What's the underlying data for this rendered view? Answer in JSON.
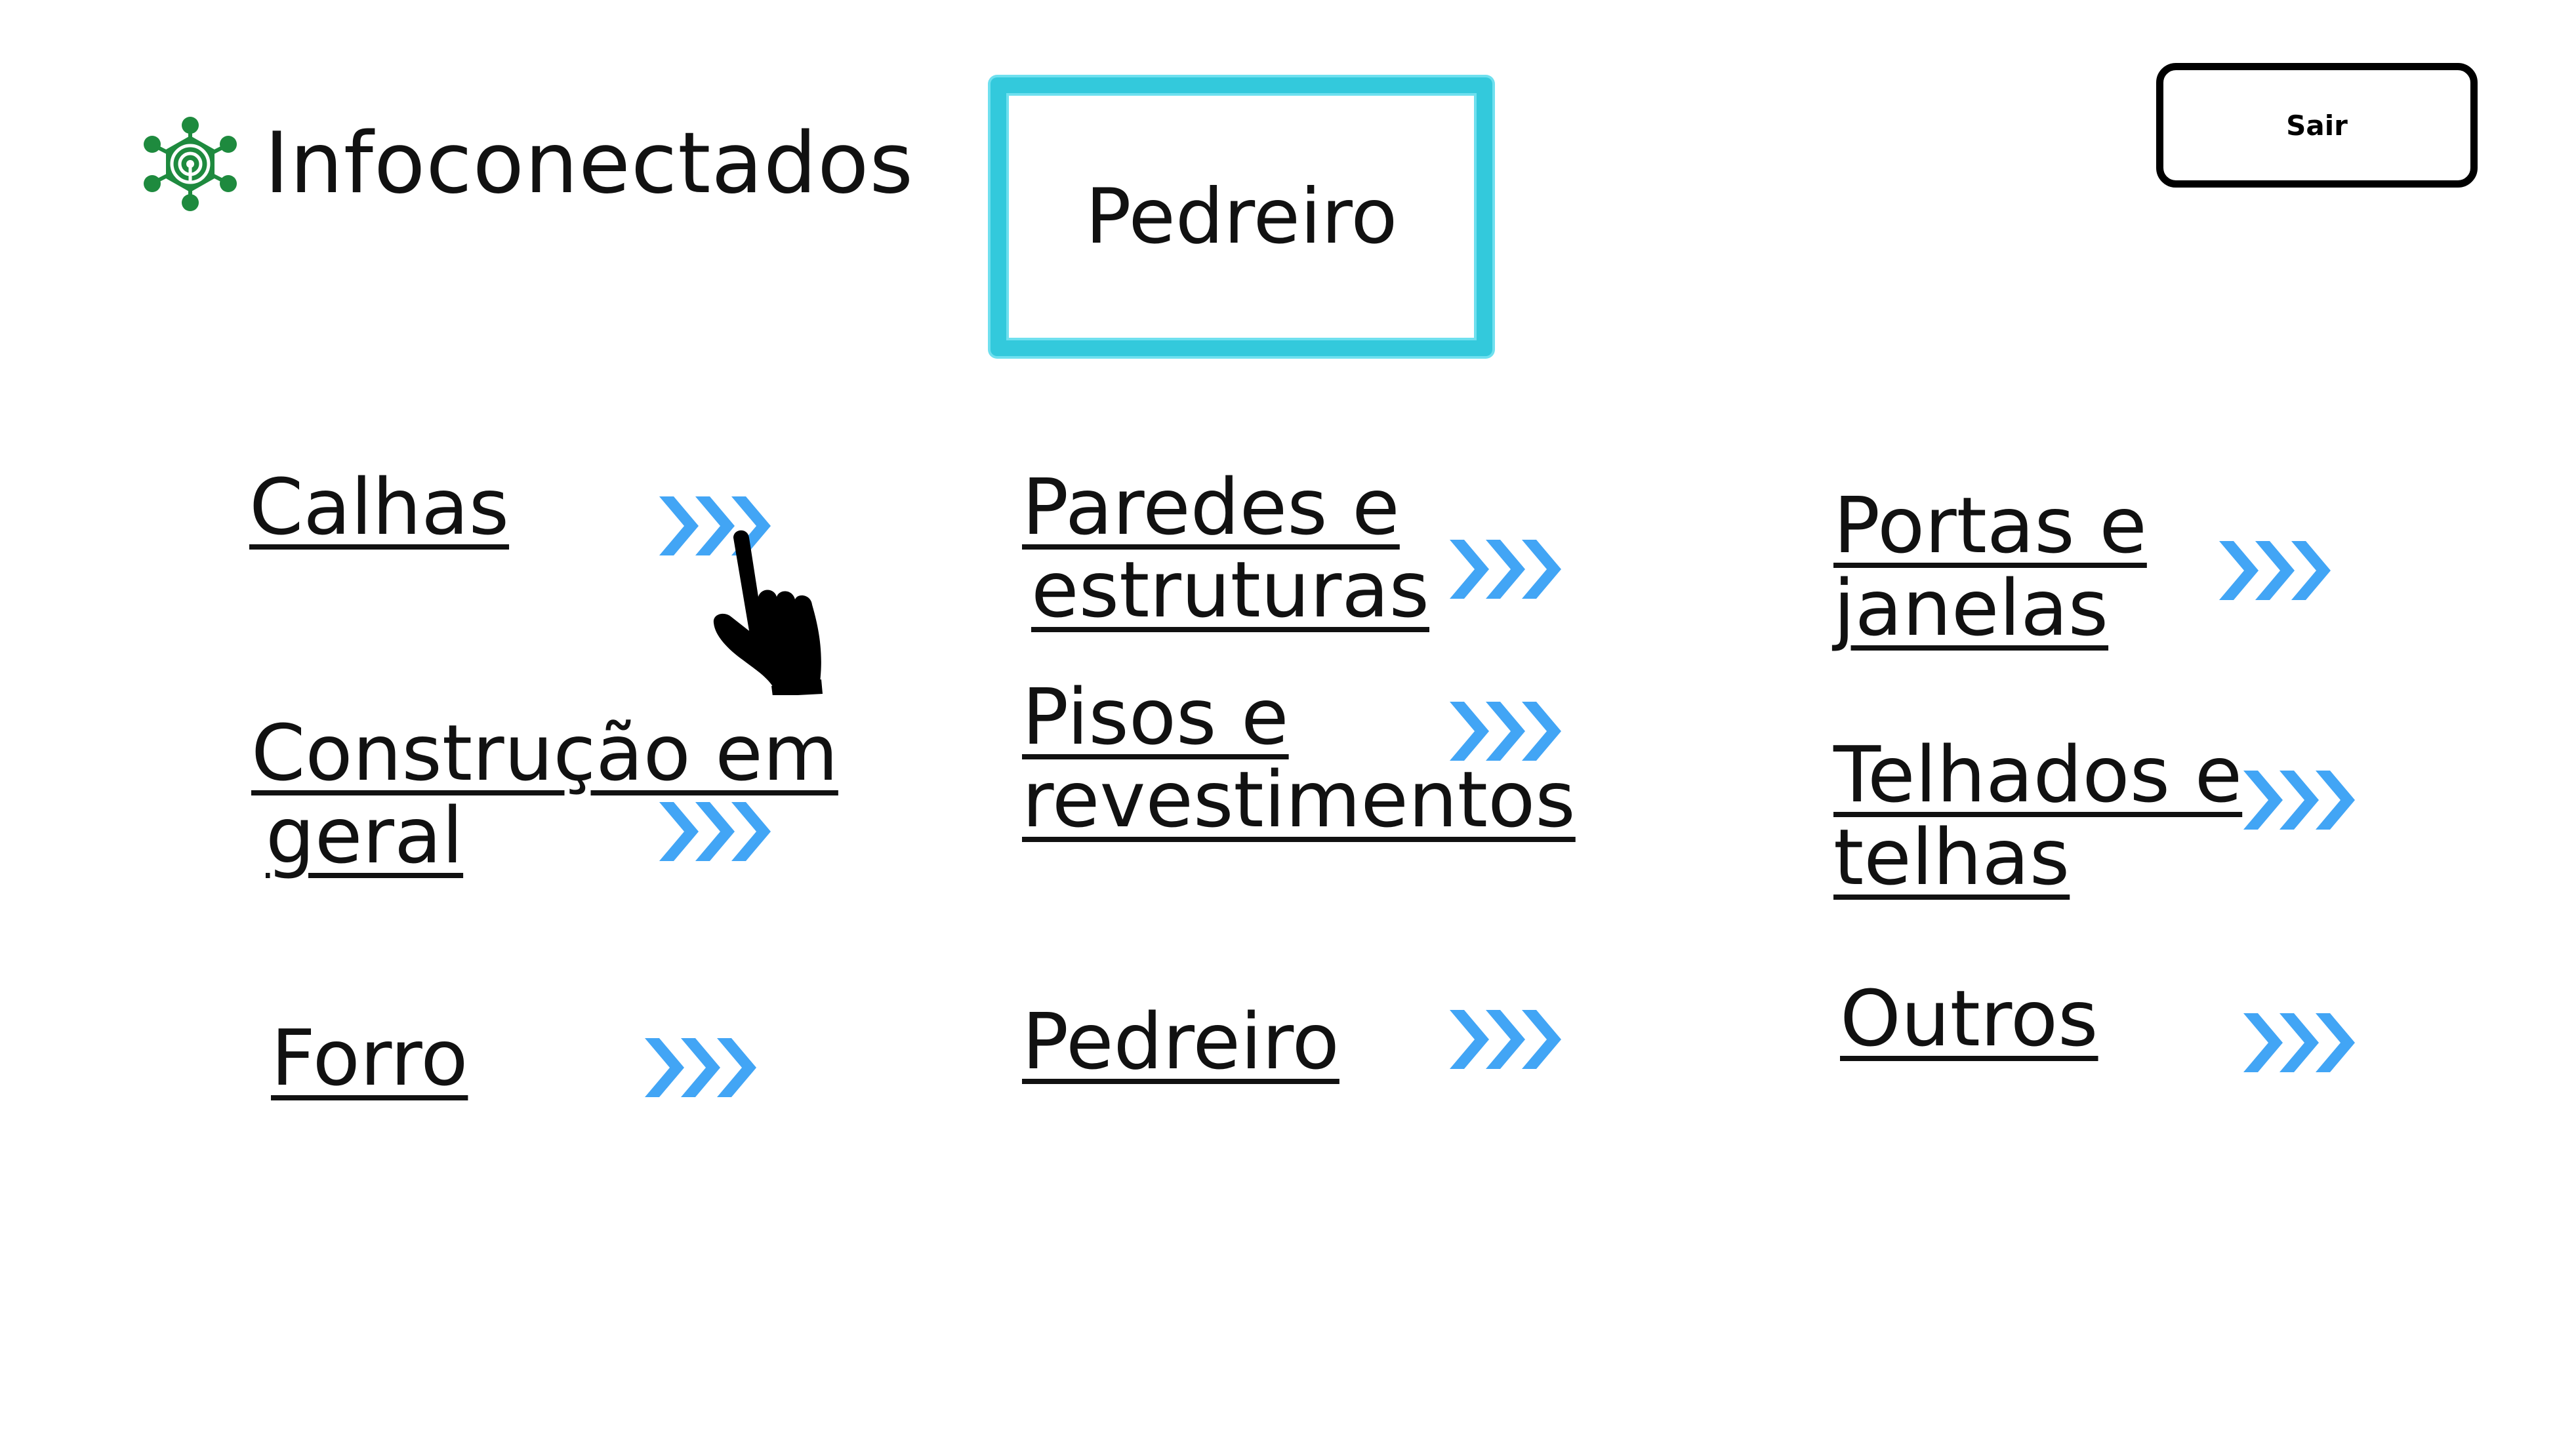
{
  "app": {
    "name": "Infoconectados",
    "logo_color": "#1e8a3e"
  },
  "header": {
    "title": "Pedreiro",
    "title_border_color": "#33c9dc",
    "logout_label": "Sair"
  },
  "accent": {
    "arrow_color": "#42a5f5",
    "arrow_icon": "triple-chevron-right-icon",
    "cursor_icon": "pointing-hand-icon"
  },
  "categories": {
    "calhas": {
      "lines": [
        "Calhas"
      ]
    },
    "construcao": {
      "lines": [
        "Construção em",
        "geral"
      ]
    },
    "forro": {
      "lines": [
        "Forro"
      ]
    },
    "paredes": {
      "lines": [
        "Paredes e",
        "estruturas"
      ]
    },
    "pisos": {
      "lines": [
        "Pisos e",
        "revestimentos"
      ]
    },
    "pedreiro": {
      "lines": [
        "Pedreiro"
      ]
    },
    "portas": {
      "lines": [
        "Portas e",
        "janelas"
      ]
    },
    "telhados": {
      "lines": [
        "Telhados e",
        "telhas"
      ]
    },
    "outros": {
      "lines": [
        "Outros"
      ]
    }
  }
}
